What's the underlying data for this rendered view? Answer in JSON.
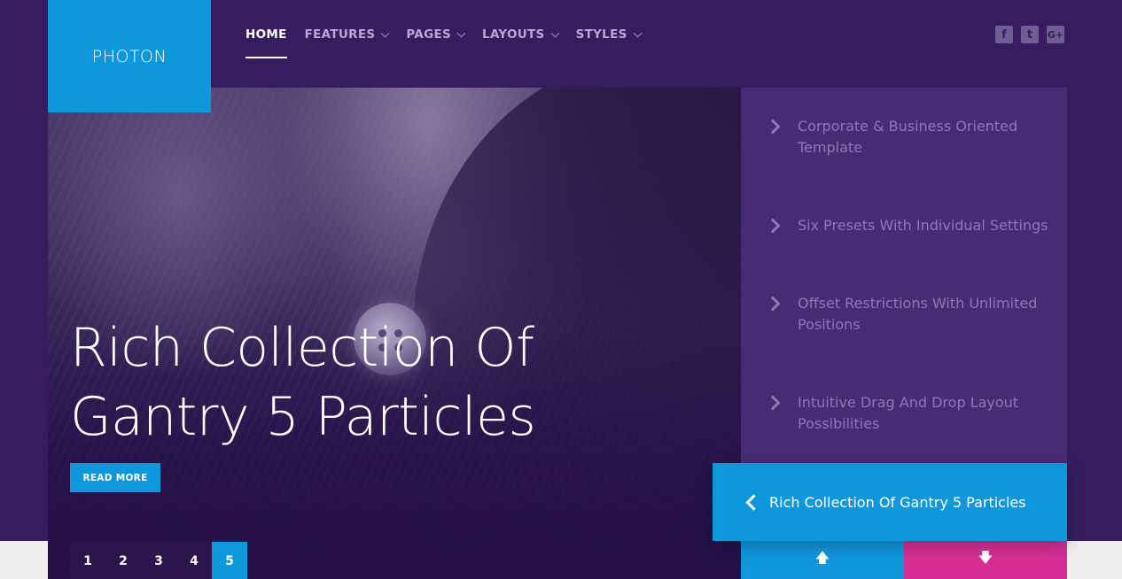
{
  "logo": {
    "text": "PHOTON"
  },
  "nav": {
    "items": [
      {
        "label": "HOME",
        "active": true,
        "dropdown": false
      },
      {
        "label": "FEATURES",
        "active": false,
        "dropdown": true
      },
      {
        "label": "PAGES",
        "active": false,
        "dropdown": true
      },
      {
        "label": "LAYOUTS",
        "active": false,
        "dropdown": true
      },
      {
        "label": "STYLES",
        "active": false,
        "dropdown": true
      }
    ]
  },
  "social": [
    {
      "icon": "facebook-icon",
      "glyph": "f"
    },
    {
      "icon": "twitter-icon",
      "glyph": "t"
    },
    {
      "icon": "google-plus-icon",
      "glyph": "G+"
    }
  ],
  "hero": {
    "title": "Rich Collection Of Gantry 5 Particles",
    "read_more": "READ MORE"
  },
  "pager": {
    "pages": [
      "1",
      "2",
      "3",
      "4",
      "5"
    ],
    "active_page": "5"
  },
  "features": [
    "Corporate & Business Oriented Template",
    "Six Presets With Individual Settings",
    "Offset Restrictions With Unlimited Positions",
    "Intuitive Drag And Drop Layout Possibilities"
  ],
  "caption": {
    "text": "Rich Collection Of Gantry 5 Particles"
  },
  "controls": {
    "up_icon": "arrow-up-icon",
    "down_icon": "arrow-down-icon",
    "up_glyph": "🡅",
    "down_glyph": "🡇"
  },
  "colors": {
    "accent_blue": "#0f97dc",
    "accent_pink": "#d52f95",
    "background": "#371d5f",
    "panel": "#472c73"
  }
}
